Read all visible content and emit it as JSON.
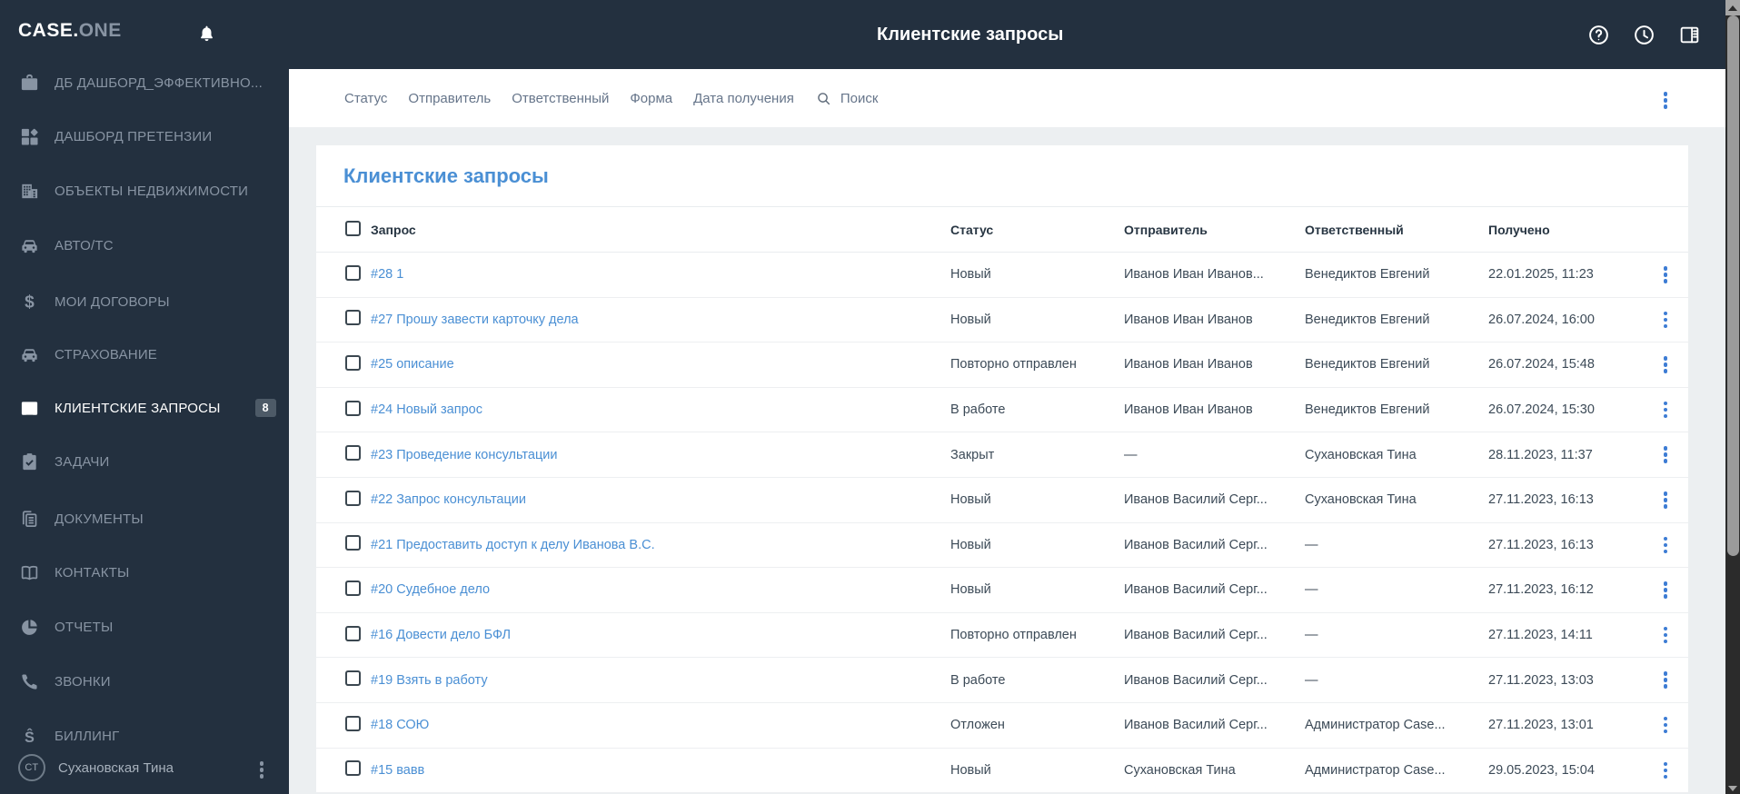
{
  "header": {
    "title": "Клиентские запросы"
  },
  "sidebar": {
    "logo_primary": "CASE.",
    "logo_secondary": "ONE",
    "items": [
      {
        "label": "ДБ ДАШБОРД_ЭФФЕКТИВНО...",
        "icon": "briefcase-icon"
      },
      {
        "label": "ДАШБОРД ПРЕТЕНЗИИ",
        "icon": "dashboard-icon"
      },
      {
        "label": "ОБЪЕКТЫ НЕДВИЖИМОСТИ",
        "icon": "building-icon"
      },
      {
        "label": "АВТО/ТС",
        "icon": "car-icon"
      },
      {
        "label": "МОИ ДОГОВОРЫ",
        "icon": "dollar-icon"
      },
      {
        "label": "СТРАХОВАНИЕ",
        "icon": "car-icon"
      },
      {
        "label": "КЛИЕНТСКИЕ ЗАПРОСЫ",
        "icon": "inbox-icon",
        "badge": "8",
        "active": true
      },
      {
        "label": "ЗАДАЧИ",
        "icon": "tasks-icon"
      },
      {
        "label": "ДОКУМЕНТЫ",
        "icon": "documents-icon"
      },
      {
        "label": "КОНТАКТЫ",
        "icon": "book-icon"
      },
      {
        "label": "ОТЧЕТЫ",
        "icon": "pie-icon"
      },
      {
        "label": "ЗВОНКИ",
        "icon": "phone-icon"
      },
      {
        "label": "БИЛЛИНГ",
        "icon": "billing-icon"
      }
    ],
    "user": {
      "initials": "СТ",
      "name": "Сухановская Тина"
    }
  },
  "filterbar": {
    "filters": [
      "Статус",
      "Отправитель",
      "Ответственный",
      "Форма",
      "Дата получения"
    ],
    "search_label": "Поиск"
  },
  "main": {
    "card_title": "Клиентские запросы",
    "columns": [
      "Запрос",
      "Статус",
      "Отправитель",
      "Ответственный",
      "Получено"
    ],
    "rows": [
      {
        "request": "#28 1",
        "status": "Новый",
        "sender": "Иванов Иван Иванов...",
        "assignee": "Венедиктов Евгений",
        "received": "22.01.2025, 11:23"
      },
      {
        "request": "#27 Прошу завести карточку дела",
        "status": "Новый",
        "sender": "Иванов Иван Иванов",
        "assignee": "Венедиктов Евгений",
        "received": "26.07.2024, 16:00"
      },
      {
        "request": "#25 описание",
        "status": "Повторно отправлен",
        "sender": "Иванов Иван Иванов",
        "assignee": "Венедиктов Евгений",
        "received": "26.07.2024, 15:48"
      },
      {
        "request": "#24 Новый запрос",
        "status": "В работе",
        "sender": "Иванов Иван Иванов",
        "assignee": "Венедиктов Евгений",
        "received": "26.07.2024, 15:30"
      },
      {
        "request": "#23 Проведение консультации",
        "status": "Закрыт",
        "sender": "—",
        "assignee": "Сухановская Тина",
        "received": "28.11.2023, 11:37"
      },
      {
        "request": "#22 Запрос консультации",
        "status": "Новый",
        "sender": "Иванов Василий Серг...",
        "assignee": "Сухановская Тина",
        "received": "27.11.2023, 16:13"
      },
      {
        "request": "#21 Предоставить доступ к делу Иванова В.С.",
        "status": "Новый",
        "sender": "Иванов Василий Серг...",
        "assignee": "—",
        "received": "27.11.2023, 16:13"
      },
      {
        "request": "#20 Судебное дело",
        "status": "Новый",
        "sender": "Иванов Василий Серг...",
        "assignee": "—",
        "received": "27.11.2023, 16:12"
      },
      {
        "request": "#16 Довести дело БФЛ",
        "status": "Повторно отправлен",
        "sender": "Иванов Василий Серг...",
        "assignee": "—",
        "received": "27.11.2023, 14:11"
      },
      {
        "request": "#19 Взять в работу",
        "status": "В работе",
        "sender": "Иванов Василий Серг...",
        "assignee": "—",
        "received": "27.11.2023, 13:03"
      },
      {
        "request": "#18 СОЮ",
        "status": "Отложен",
        "sender": "Иванов Василий Серг...",
        "assignee": "Администратор Case...",
        "received": "27.11.2023, 13:01"
      },
      {
        "request": "#15 вавв",
        "status": "Новый",
        "sender": "Сухановская Тина",
        "assignee": "Администратор Case...",
        "received": "29.05.2023, 15:04"
      }
    ]
  },
  "colors": {
    "sidebar_bg": "#23303f",
    "content_bg": "#eceff1",
    "accent_blue": "#4a8fd4",
    "menu_dots_blue": "#3d7cd4",
    "badge_bg": "#4d5a67",
    "scrollbar_track": "#2b2b2b",
    "scrollbar_thumb": "#9b9b9b"
  }
}
